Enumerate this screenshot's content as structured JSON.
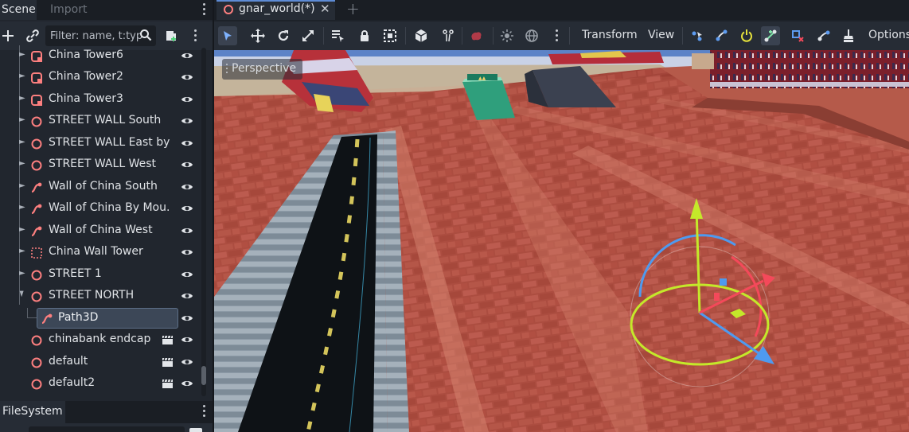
{
  "left_dock": {
    "tabs": {
      "scene": "Scene",
      "import": "Import"
    },
    "filter": {
      "placeholder": "Filter: name, t:typ"
    },
    "tree": [
      {
        "label": "China Tower6",
        "icon": "instance-scene-icon",
        "expandable": true
      },
      {
        "label": "China Tower2",
        "icon": "instance-scene-icon",
        "expandable": true
      },
      {
        "label": "China Tower3",
        "icon": "instance-scene-icon",
        "expandable": true
      },
      {
        "label": "STREET WALL South",
        "icon": "node3d-icon",
        "expandable": true
      },
      {
        "label": "STREET WALL East by ...",
        "icon": "node3d-icon",
        "expandable": true
      },
      {
        "label": "STREET WALL West",
        "icon": "node3d-icon",
        "expandable": true
      },
      {
        "label": "Wall of China South",
        "icon": "path3d-icon",
        "expandable": true
      },
      {
        "label": "Wall of China By Mou...",
        "icon": "path3d-icon",
        "expandable": true
      },
      {
        "label": "Wall of China West",
        "icon": "path3d-icon",
        "expandable": true
      },
      {
        "label": "China Wall Tower",
        "icon": "multimesh-icon",
        "expandable": true
      },
      {
        "label": "STREET 1",
        "icon": "node3d-icon",
        "expandable": true
      },
      {
        "label": "STREET NORTH",
        "icon": "node3d-icon",
        "expandable": true,
        "expanded": true
      },
      {
        "label": "Path3D",
        "icon": "path3d-icon",
        "selected": true,
        "child": true
      },
      {
        "label": "chinabank endcap",
        "icon": "node3d-icon",
        "clapper": true
      },
      {
        "label": "default",
        "icon": "node3d-icon",
        "clapper": true
      },
      {
        "label": "default2",
        "icon": "node3d-icon",
        "clapper": true
      }
    ],
    "filesystem_tab": "FileSystem"
  },
  "scene_tabs": {
    "active": "gnar_world(*)"
  },
  "viewport_toolbar": {
    "transform_menu": "Transform",
    "view_menu": "View",
    "options_menu": "Options"
  },
  "viewport": {
    "perspective_label": "Perspective"
  },
  "colors": {
    "accent": "#5d8bd5",
    "node3d": "#fc7f7f",
    "selected_row": "#3c4757",
    "gizmo_x": "#f4495a",
    "gizmo_y": "#c4e82a",
    "gizmo_z": "#4e9aef"
  }
}
